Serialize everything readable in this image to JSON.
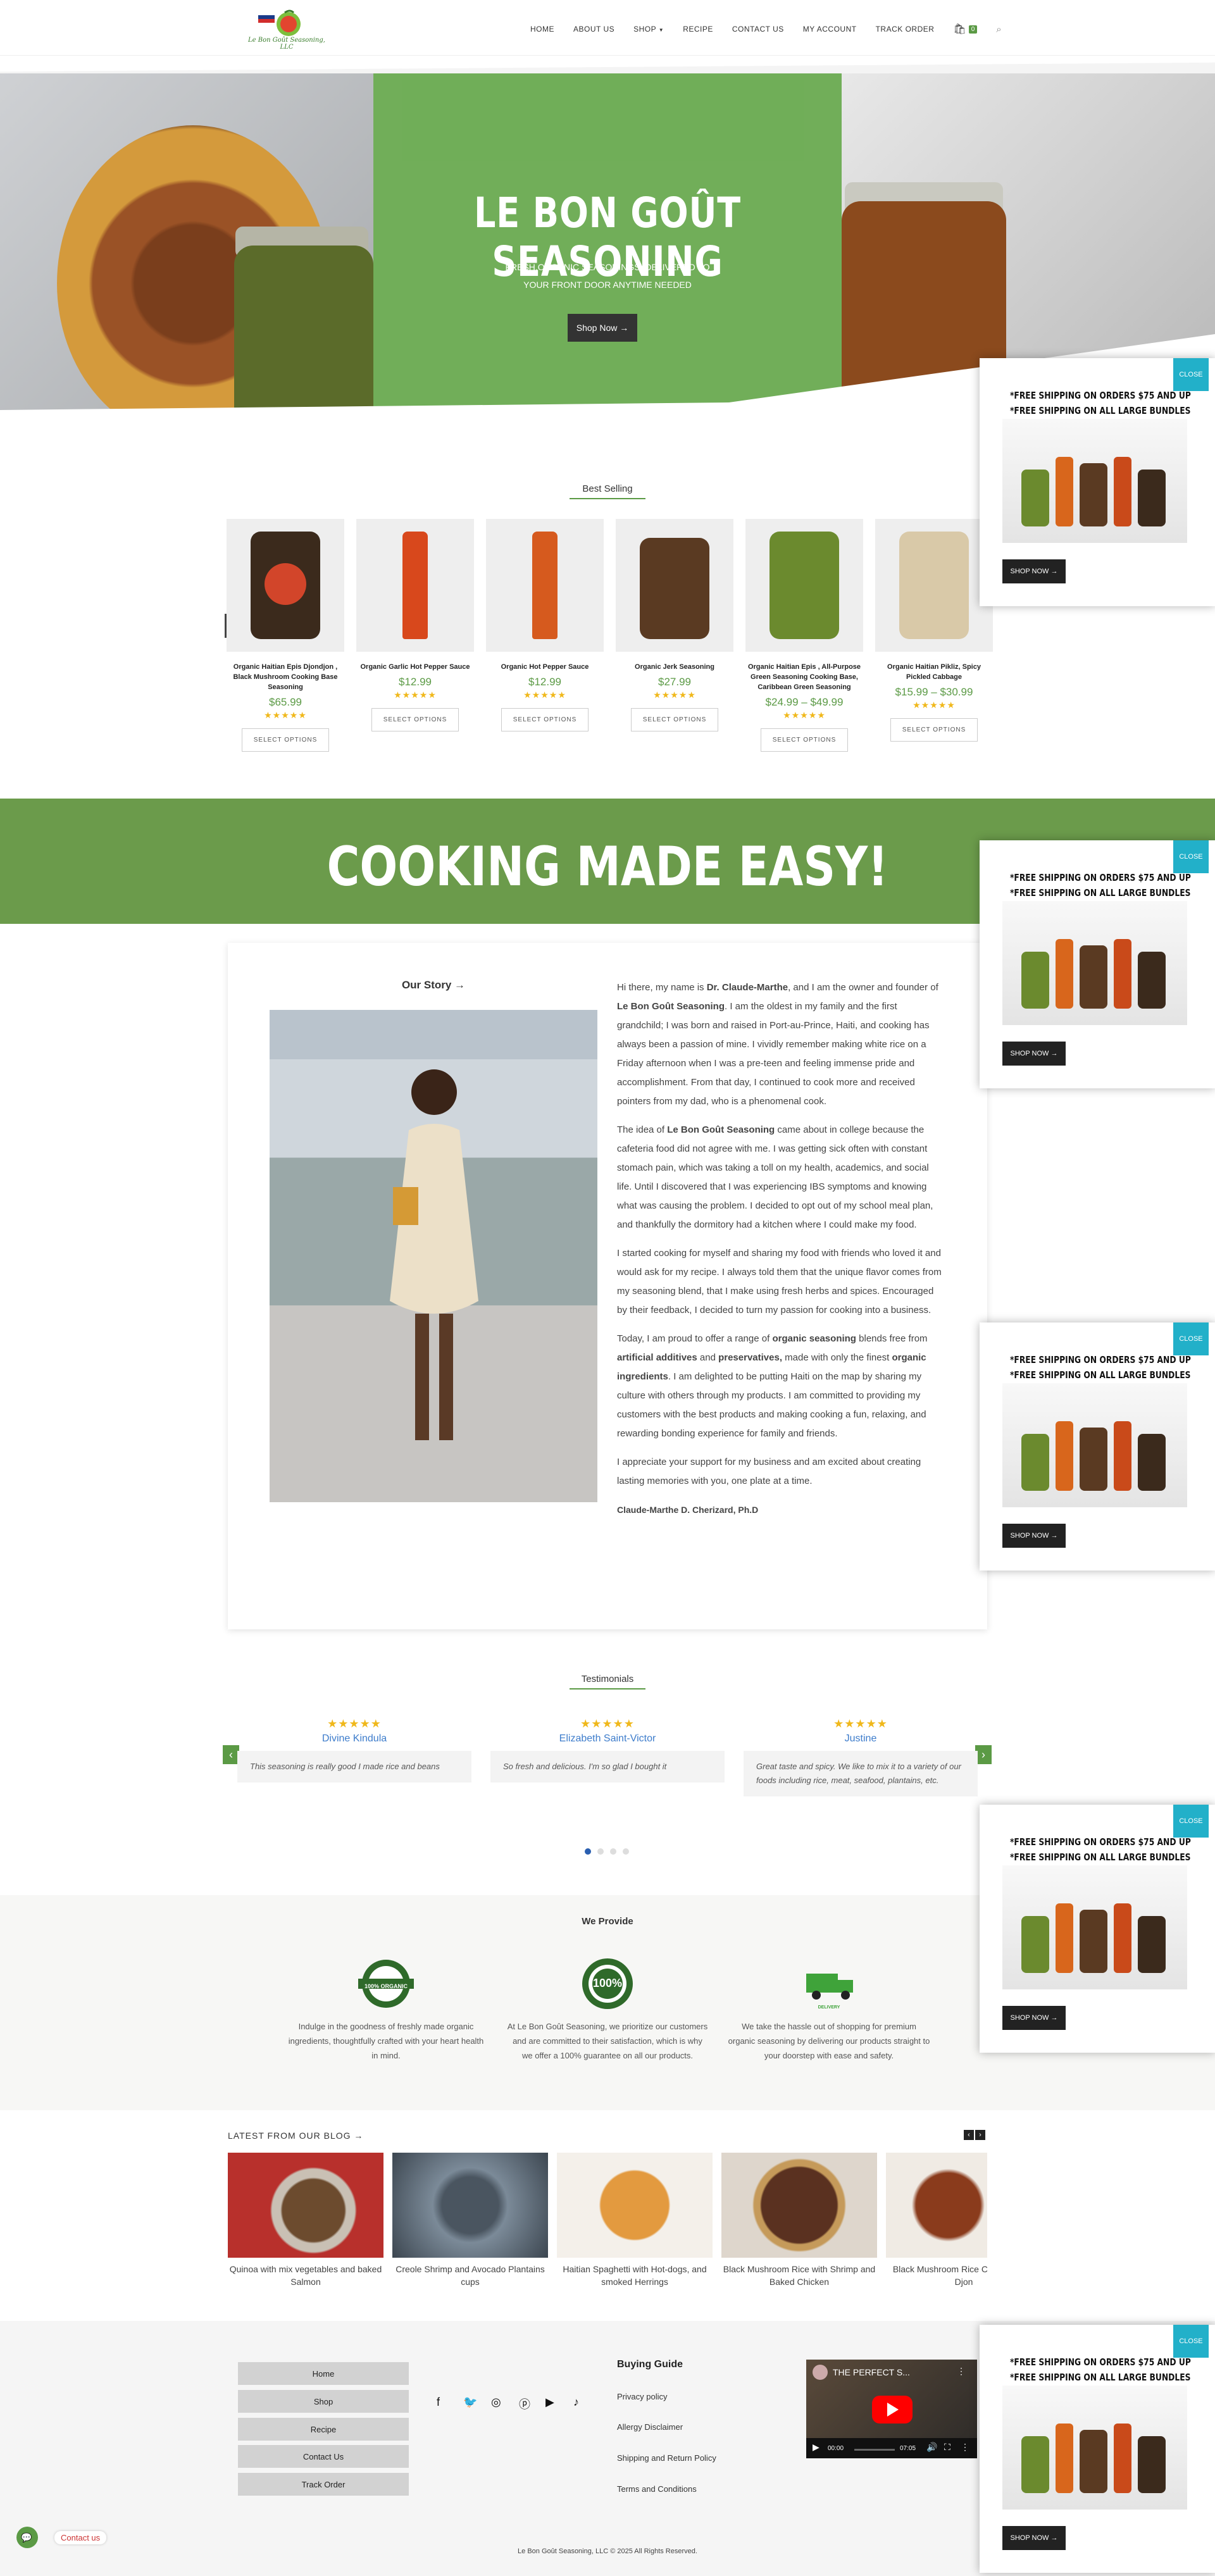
{
  "header": {
    "logo_text": "Le Bon Goût Seasoning, LLC",
    "nav": [
      "HOME",
      "ABOUT US",
      "SHOP",
      "RECIPE",
      "CONTACT US",
      "MY ACCOUNT",
      "TRACK ORDER"
    ],
    "cart_count": "0"
  },
  "hero": {
    "title": "LE BON GOÛT SEASONING",
    "subtitle_line1": "FRESH,ORGANIC SEASONINGS, DELIVERED TO",
    "subtitle_line2": "YOUR FRONT DOOR ANYTIME NEEDED",
    "button": "Shop Now →"
  },
  "best_selling": {
    "title": "Best Selling",
    "products": [
      {
        "name": "Organic Haitian Epis Djondjon , Black Mushroom Cooking Base Seasoning",
        "price": "$65.99",
        "button": "SELECT OPTIONS"
      },
      {
        "name": "Organic Garlic Hot Pepper Sauce",
        "price": "$12.99",
        "button": "SELECT OPTIONS"
      },
      {
        "name": "Organic Hot Pepper Sauce",
        "price": "$12.99",
        "button": "SELECT OPTIONS"
      },
      {
        "name": "Organic Jerk Seasoning",
        "price": "$27.99",
        "button": "SELECT OPTIONS"
      },
      {
        "name": "Organic Haitian Epis , All-Purpose Green Seasoning Cooking Base, Caribbean Green Seasoning",
        "price": "$24.99 – $49.99",
        "button": "SELECT OPTIONS"
      },
      {
        "name": "Organic Haitian Pikliz, Spicy Pickled Cabbage",
        "price": "$15.99 – $30.99",
        "button": "SELECT OPTIONS"
      }
    ],
    "rating": "★★★★★"
  },
  "popup": {
    "close": "CLOSE",
    "line1": "*FREE SHIPPING ON ORDERS $75 AND UP",
    "line2": "*FREE SHIPPING ON ALL LARGE BUNDLES",
    "button": "SHOP NOW →"
  },
  "cooking": {
    "title": "COOKING MADE EASY!"
  },
  "story": {
    "link": "Our Story →",
    "p1_a": "Hi there, my name is ",
    "p1_name": "Dr. Claude-Marthe",
    "p1_b": ", and I am the owner and founder of ",
    "p1_brand": "Le Bon Goût Seasoning",
    "p1_c": ". I am the oldest in my family and the first grandchild; I was born and raised in Port-au-Prince, Haiti, and cooking has always been a passion of mine. I vividly remember making white rice on a Friday afternoon when I was a pre-teen and feeling immense pride and accomplishment. From that day, I continued to cook more and received pointers from my dad, who is a phenomenal cook.",
    "p2_a": "The idea of ",
    "p2_brand": "Le Bon Goût Seasoning",
    "p2_b": " came about in college because the cafeteria food did not agree with me. I was getting sick often with constant stomach pain, which was taking a toll on my health, academics, and social life. Until I discovered that I was experiencing IBS symptoms and knowing what was causing the problem. I decided to opt out of my school meal plan, and thankfully the dormitory had a kitchen where I could make my food.",
    "p3": "I started cooking for myself and sharing my food with friends who loved it and would ask for my recipe. I always told them that the unique flavor comes from my seasoning blend, that I make using fresh herbs and spices. Encouraged by their feedback, I decided to turn my passion for cooking into a business.",
    "p4_a": "Today, I am proud to offer a range of ",
    "p4_b1": "organic seasoning",
    "p4_c": " blends free from ",
    "p4_b2": "artificial additives",
    "p4_d": " and ",
    "p4_b3": "preservatives,",
    "p4_e": " made with only the finest ",
    "p4_b4": "organic ingredients",
    "p4_f": ". I am delighted to be putting Haiti on the map by sharing my culture with others through my products. I am committed to providing my customers with the best products and making cooking a fun, relaxing, and rewarding bonding experience for family and friends.",
    "p5": "I appreciate your support for my business and am excited about creating lasting memories with you, one plate at a time.",
    "signature": "Claude-Marthe D. Cherizard, Ph.D"
  },
  "testimonials": {
    "title": "Testimonials",
    "items": [
      {
        "name": "Divine Kindula",
        "text": "This seasoning is really good I made rice and beans"
      },
      {
        "name": "Elizabeth Saint-Victor",
        "text": "So fresh and delicious. I'm so glad I bought it"
      },
      {
        "name": "Justine",
        "text": "Great taste and spicy. We like to mix it to a variety of our foods including rice, meat, seafood, plantains, etc."
      }
    ],
    "rating": "★★★★★"
  },
  "provide": {
    "title": "We Provide",
    "items": [
      {
        "badge": "100% ORGANIC",
        "text": "Indulge in the goodness of freshly made organic ingredients, thoughtfully crafted with your heart health in mind."
      },
      {
        "badge": "100%",
        "text": "At Le Bon Goût Seasoning, we prioritize our customers and are committed to their satisfaction, which is why we offer a 100% guarantee on all our products."
      },
      {
        "badge": "DELIVERY",
        "text": "We take the hassle out of shopping for premium organic seasoning by delivering our products straight to your doorstep with ease and safety."
      }
    ]
  },
  "blog": {
    "title": "LATEST FROM OUR BLOG →",
    "posts": [
      "Quinoa with mix vegetables and baked Salmon",
      "Creole Shrimp and Avocado Plantains cups",
      "Haitian Spaghetti with Hot-dogs, and smoked Herrings",
      "Black Mushroom Rice with Shrimp and Baked Chicken",
      "Black Mushroom Rice Chicken \" Diri Djon"
    ]
  },
  "footer": {
    "buttons": [
      "Home",
      "Shop",
      "Recipe",
      "Contact Us",
      "Track Order"
    ],
    "guide_title": "Buying Guide",
    "guide_links": [
      "Privacy policy",
      "Allergy Disclaimer",
      "Shipping and Return Policy",
      "Terms and Conditions"
    ],
    "video_title": "THE PERFECT S...",
    "video_time": "00:00",
    "video_duration": "07:05",
    "copyright": "Le Bon Goût Seasoning, LLC © 2025 All Rights Reserved.",
    "chat": "Contact us"
  }
}
